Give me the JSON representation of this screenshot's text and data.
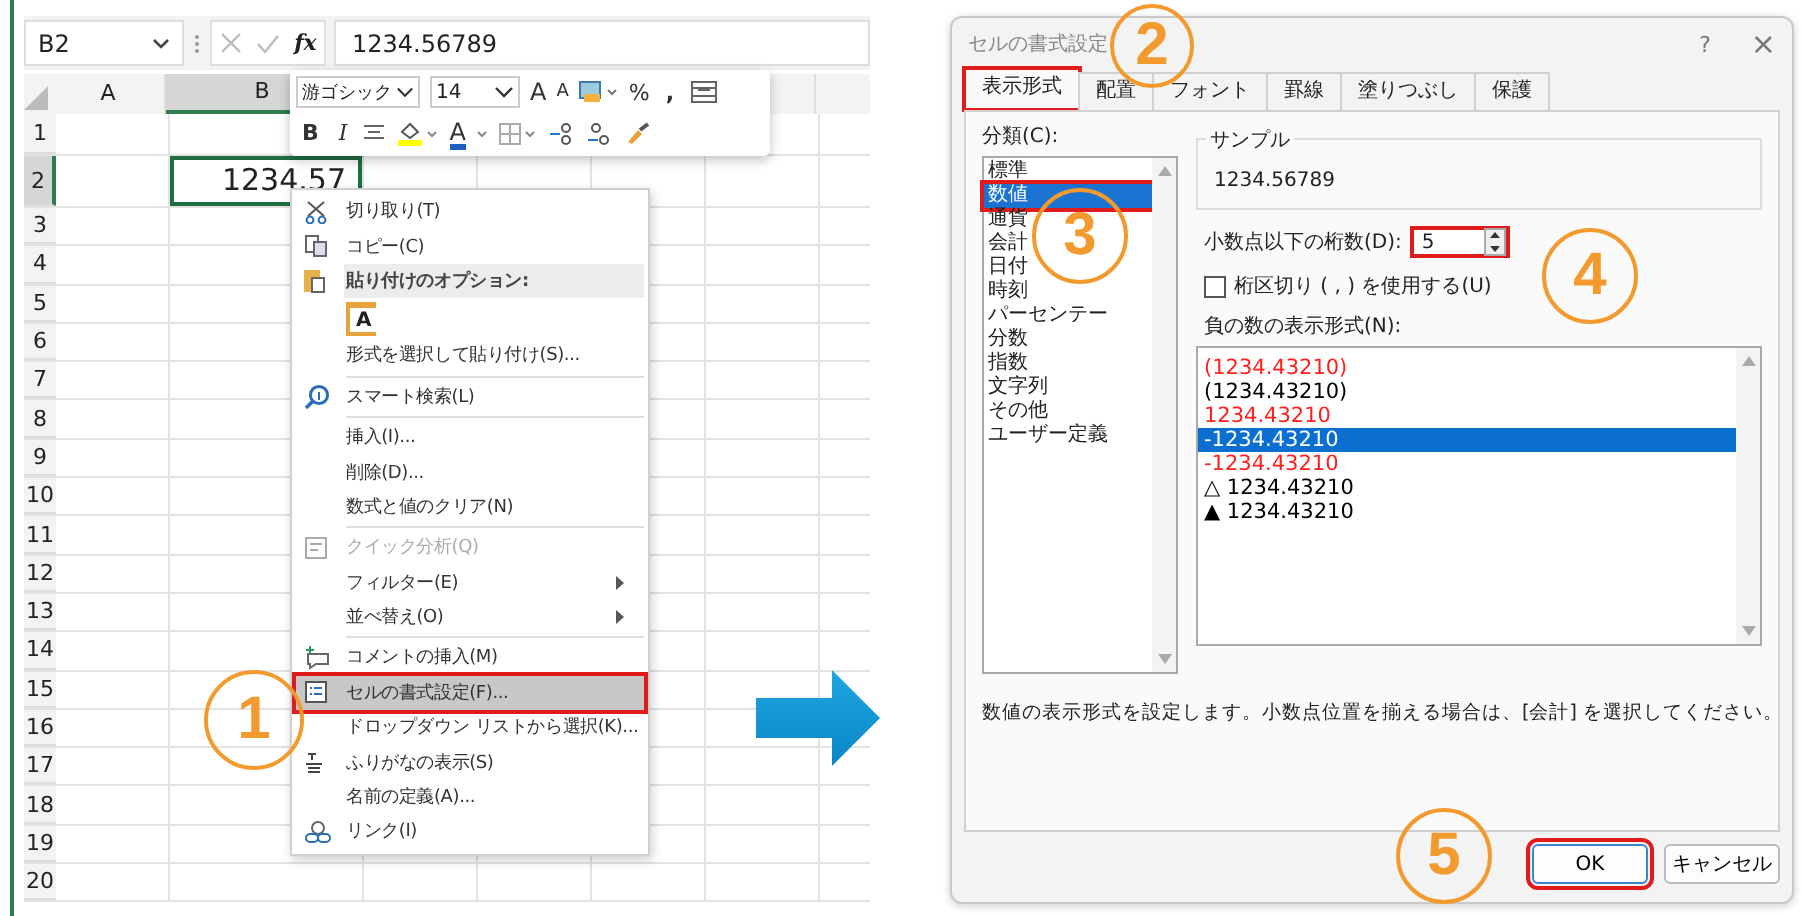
{
  "formula_bar": {
    "name_box": "B2",
    "fx": "fx",
    "formula": "1234.56789"
  },
  "mini_toolbar": {
    "font": "游ゴシック",
    "size": "14",
    "grow_font": "A",
    "shrink_font": "A",
    "percent": "%",
    "comma": ",",
    "bold": "B",
    "italic": "I",
    "font_color": "A"
  },
  "sheet": {
    "columns": [
      {
        "label": "A",
        "selected": false
      },
      {
        "label": "B",
        "selected": true
      }
    ],
    "rows": [
      {
        "label": "1",
        "selected": false
      },
      {
        "label": "2",
        "selected": true
      },
      {
        "label": "3",
        "selected": false
      },
      {
        "label": "4",
        "selected": false
      },
      {
        "label": "5",
        "selected": false
      },
      {
        "label": "6",
        "selected": false
      },
      {
        "label": "7",
        "selected": false
      },
      {
        "label": "8",
        "selected": false
      },
      {
        "label": "9",
        "selected": false
      },
      {
        "label": "10",
        "selected": false
      },
      {
        "label": "11",
        "selected": false
      },
      {
        "label": "12",
        "selected": false
      },
      {
        "label": "13",
        "selected": false
      },
      {
        "label": "14",
        "selected": false
      },
      {
        "label": "15",
        "selected": false
      },
      {
        "label": "16",
        "selected": false
      },
      {
        "label": "17",
        "selected": false
      },
      {
        "label": "18",
        "selected": false
      },
      {
        "label": "19",
        "selected": false
      },
      {
        "label": "20",
        "selected": false
      }
    ],
    "cell": "1234.57"
  },
  "context_menu": {
    "items": [
      {
        "kind": "cut",
        "label": "切り取り(T)",
        "selected": false,
        "disabled": false,
        "highlighted": false
      },
      {
        "kind": "copy",
        "label": "コピー(C)",
        "selected": false,
        "disabled": false,
        "highlighted": false
      },
      {
        "kind": "header",
        "label": "貼り付けのオプション:"
      },
      {
        "kind": "paste",
        "label": "A"
      },
      {
        "kind": "plain",
        "label": "形式を選択して貼り付け(S)...",
        "selected": false,
        "disabled": false,
        "highlighted": false
      },
      {
        "kind": "separator"
      },
      {
        "kind": "search",
        "label": "スマート検索(L)",
        "selected": false,
        "disabled": false,
        "highlighted": false
      },
      {
        "kind": "separator"
      },
      {
        "kind": "plain",
        "label": "挿入(I)...",
        "selected": false,
        "disabled": false,
        "highlighted": false
      },
      {
        "kind": "plain",
        "label": "削除(D)...",
        "selected": false,
        "disabled": false,
        "highlighted": false
      },
      {
        "kind": "plain",
        "label": "数式と値のクリア(N)",
        "selected": false,
        "disabled": false,
        "highlighted": false
      },
      {
        "kind": "separator"
      },
      {
        "kind": "analysis",
        "label": "クイック分析(Q)",
        "selected": false,
        "disabled": true,
        "highlighted": false
      },
      {
        "kind": "submenu",
        "label": "フィルター(E)",
        "selected": false,
        "disabled": false,
        "highlighted": false
      },
      {
        "kind": "submenu",
        "label": "並べ替え(O)",
        "selected": false,
        "disabled": false,
        "highlighted": false
      },
      {
        "kind": "separator"
      },
      {
        "kind": "comment",
        "label": "コメントの挿入(M)",
        "selected": false,
        "disabled": false,
        "highlighted": false
      },
      {
        "kind": "format",
        "label": "セルの書式設定(F)...",
        "selected": true,
        "disabled": false,
        "highlighted": true
      },
      {
        "kind": "plain",
        "label": "ドロップダウン リストから選択(K)...",
        "selected": false,
        "disabled": false,
        "highlighted": false
      },
      {
        "kind": "furigana",
        "label": "ふりがなの表示(S)",
        "selected": false,
        "disabled": false,
        "highlighted": false
      },
      {
        "kind": "plain",
        "label": "名前の定義(A)...",
        "selected": false,
        "disabled": false,
        "highlighted": false
      },
      {
        "kind": "link",
        "label": "リンク(I)",
        "selected": false,
        "disabled": false,
        "highlighted": false
      }
    ]
  },
  "dialog": {
    "title": "セルの書式設定",
    "help": "?",
    "close": "×",
    "tabs": [
      {
        "label": "表示形式",
        "selected": true,
        "highlighted": true
      },
      {
        "label": "配置",
        "selected": false,
        "highlighted": false
      },
      {
        "label": "フォント",
        "selected": false,
        "highlighted": false
      },
      {
        "label": "罫線",
        "selected": false,
        "highlighted": false
      },
      {
        "label": "塗りつぶし",
        "selected": false,
        "highlighted": false
      },
      {
        "label": "保護",
        "selected": false,
        "highlighted": false
      }
    ],
    "category_label": "分類(C):",
    "categories": [
      {
        "label": "標準",
        "selected": false,
        "highlighted": false
      },
      {
        "label": "数値",
        "selected": true,
        "highlighted": true
      },
      {
        "label": "通貨",
        "selected": false,
        "highlighted": false
      },
      {
        "label": "会計",
        "selected": false,
        "highlighted": false
      },
      {
        "label": "日付",
        "selected": false,
        "highlighted": false
      },
      {
        "label": "時刻",
        "selected": false,
        "highlighted": false
      },
      {
        "label": "パーセンテー",
        "selected": false,
        "highlighted": false
      },
      {
        "label": "分数",
        "selected": false,
        "highlighted": false
      },
      {
        "label": "指数",
        "selected": false,
        "highlighted": false
      },
      {
        "label": "文字列",
        "selected": false,
        "highlighted": false
      },
      {
        "label": "その他",
        "selected": false,
        "highlighted": false
      },
      {
        "label": "ユーザー定義",
        "selected": false,
        "highlighted": false
      }
    ],
    "sample_label": "サンプル",
    "sample": "1234.56789",
    "decimals_label": "小数点以下の桁数(D):",
    "decimals": {
      "value": "5",
      "highlighted": true
    },
    "separator_checkbox": {
      "label": "桁区切り ( , ) を使用する(U)",
      "checked": false
    },
    "negative_label": "負の数の表示形式(N):",
    "negative_formats": [
      {
        "label": "(1234.43210)",
        "color": "#ff2020",
        "selected": false
      },
      {
        "label": "(1234.43210)",
        "color": "#000000",
        "selected": false
      },
      {
        "label": "1234.43210",
        "color": "#ff2020",
        "selected": false
      },
      {
        "label": "-1234.43210",
        "selected": true
      },
      {
        "label": "-1234.43210",
        "color": "#ff2020",
        "selected": false
      },
      {
        "label": "△ 1234.43210",
        "color": "#000000",
        "selected": false
      },
      {
        "label": "▲ 1234.43210",
        "color": "#000000",
        "selected": false
      }
    ],
    "description": "数値の表示形式を設定します。小数点位置を揃える場合は、[会計] を選択してください。",
    "buttons": [
      {
        "label": "OK",
        "highlighted": true
      },
      {
        "label": "キャンセル",
        "highlighted": false
      }
    ]
  },
  "steps": [
    {
      "number": "1"
    },
    {
      "number": "2"
    },
    {
      "number": "3"
    },
    {
      "number": "4"
    },
    {
      "number": "5"
    }
  ]
}
